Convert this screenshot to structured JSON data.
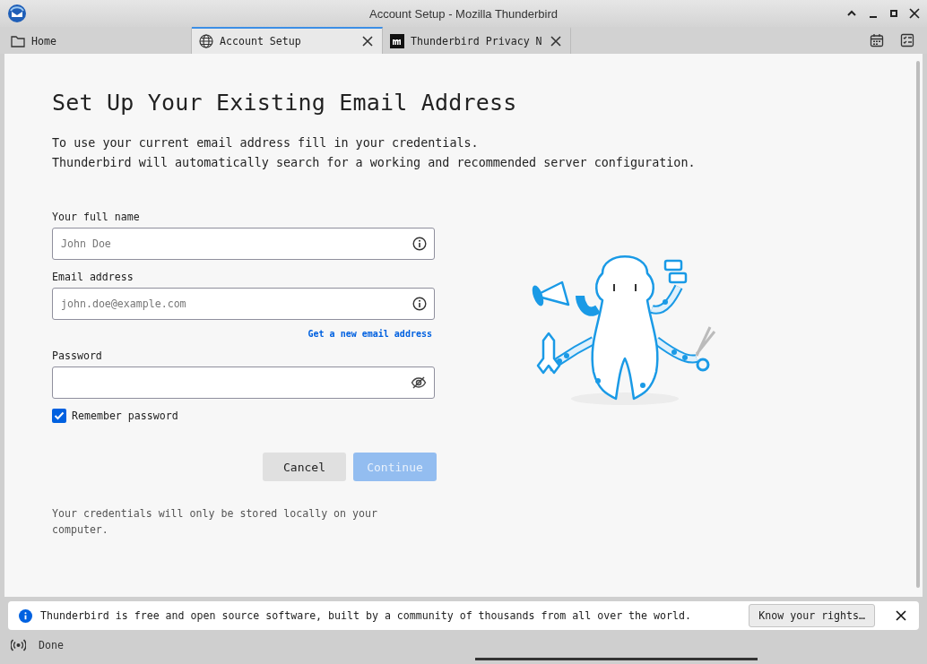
{
  "window": {
    "title": "Account Setup - Mozilla Thunderbird"
  },
  "tabs": [
    {
      "label": "Home",
      "selected": false,
      "closable": false
    },
    {
      "label": "Account Setup",
      "selected": true,
      "closable": true
    },
    {
      "label": "Thunderbird Privacy N",
      "selected": false,
      "closable": true
    }
  ],
  "setup": {
    "heading": "Set Up Your Existing Email Address",
    "intro": [
      "To use your current email address fill in your credentials.",
      "Thunderbird will automatically search for a working and recommended server configuration."
    ],
    "fields": [
      {
        "label": "Your full name",
        "placeholder": "John Doe",
        "kind": "info"
      },
      {
        "label": "Email address",
        "placeholder": "john.doe@example.com",
        "kind": "info",
        "link": "Get a new email address"
      },
      {
        "label": "Password",
        "kind": "password"
      }
    ],
    "remember_password": {
      "label": "Remember password",
      "checked": true
    },
    "buttons": [
      {
        "label": "Cancel",
        "disabled": false
      },
      {
        "label": "Continue",
        "disabled": true
      }
    ],
    "note": "Your credentials will only be stored locally on your computer."
  },
  "notification": {
    "message": "Thunderbird is free and open source software, built by a community of thousands from all over the world.",
    "button": "Know your rights…"
  },
  "status_bar": {
    "text": "Done"
  }
}
